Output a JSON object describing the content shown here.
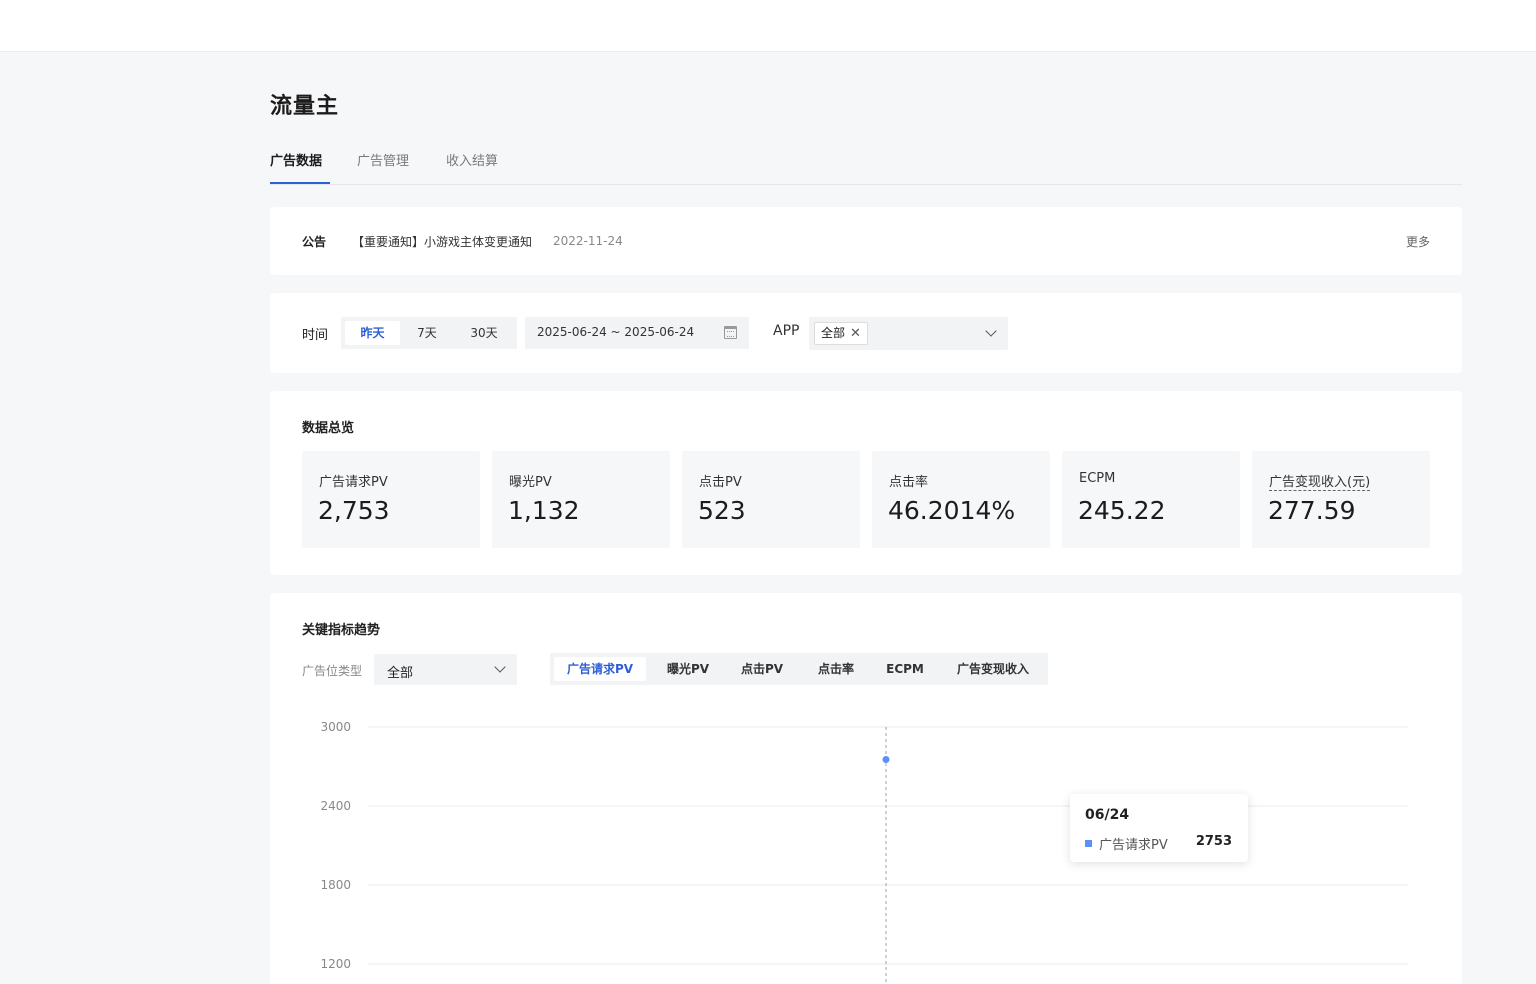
{
  "page": {
    "title": "流量主"
  },
  "tabs": [
    {
      "label": "广告数据",
      "active": true
    },
    {
      "label": "广告管理",
      "active": false
    },
    {
      "label": "收入结算",
      "active": false
    }
  ],
  "notice": {
    "label": "公告",
    "text": "【重要通知】小游戏主体变更通知",
    "date": "2022-11-24",
    "more": "更多"
  },
  "filter": {
    "time_label": "时间",
    "ranges": [
      {
        "label": "昨天",
        "active": true
      },
      {
        "label": "7天",
        "active": false
      },
      {
        "label": "30天",
        "active": false
      }
    ],
    "date_range": "2025-06-24 ~ 2025-06-24",
    "app_label": "APP",
    "app_tag": "全部",
    "icons": {
      "calendar": "calendar-icon",
      "close": "close-icon",
      "dropdown": "chevron-down-icon"
    }
  },
  "overview": {
    "title": "数据总览",
    "metrics": [
      {
        "label": "广告请求PV",
        "value": "2,753"
      },
      {
        "label": "曝光PV",
        "value": "1,132"
      },
      {
        "label": "点击PV",
        "value": "523"
      },
      {
        "label": "点击率",
        "value": "46.2014%"
      },
      {
        "label": "ECPM",
        "value": "245.22"
      },
      {
        "label": "广告变现收入(元)",
        "value": "277.59"
      }
    ]
  },
  "trend": {
    "title": "关键指标趋势",
    "ad_type_label": "广告位类型",
    "ad_type_value": "全部",
    "metric_tabs": [
      {
        "label": "广告请求PV",
        "active": true
      },
      {
        "label": "曝光PV",
        "active": false
      },
      {
        "label": "点击PV",
        "active": false
      },
      {
        "label": "点击率",
        "active": false
      },
      {
        "label": "ECPM",
        "active": false
      },
      {
        "label": "广告变现收入",
        "active": false
      }
    ],
    "tooltip": {
      "date": "06/24",
      "series": "广告请求PV",
      "value": "2753"
    }
  },
  "colors": {
    "accent": "#2f5fd6",
    "series": "#5b8ff9",
    "grid": "#e9ebee"
  },
  "chart_data": {
    "type": "line",
    "x": [
      "06/24"
    ],
    "series": [
      {
        "name": "广告请求PV",
        "values": [
          2753
        ]
      }
    ],
    "y_ticks": [
      3000,
      2400,
      1800,
      1200
    ],
    "ylim": [
      1200,
      3000
    ],
    "grid": true
  }
}
